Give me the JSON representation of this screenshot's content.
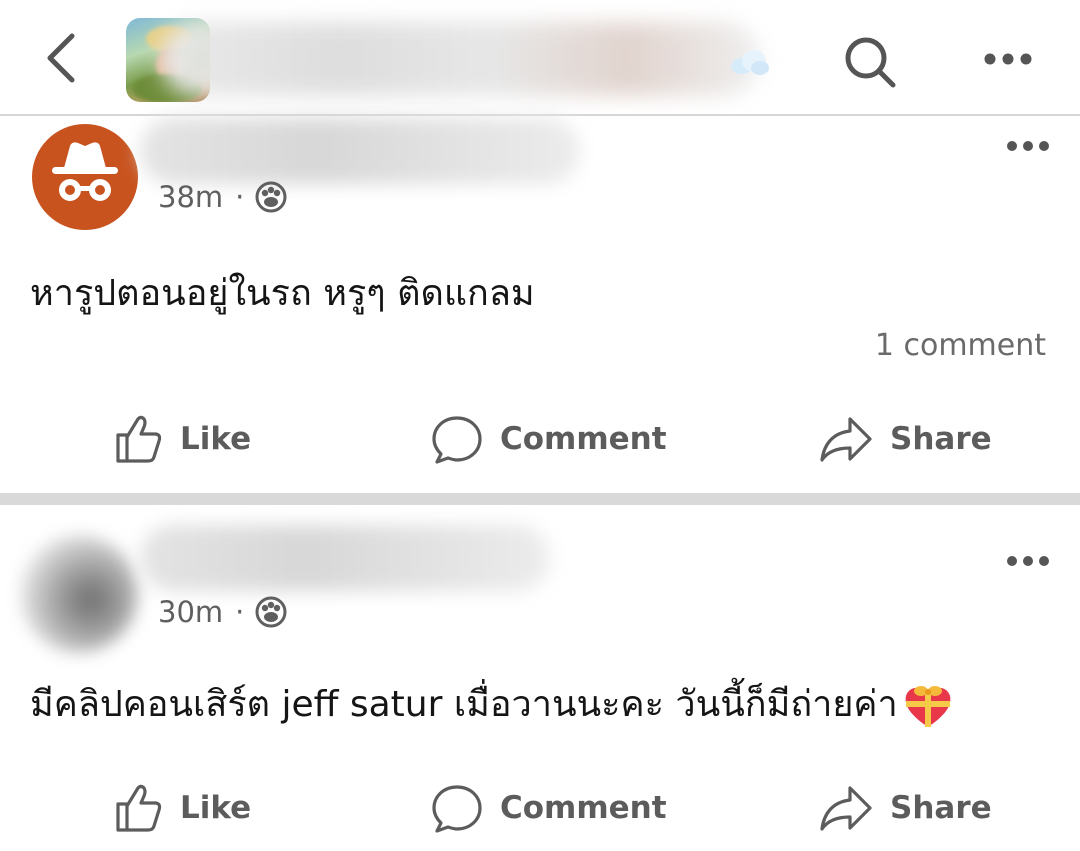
{
  "posts": [
    {
      "time": "38m",
      "dot": "·",
      "text": "หารูปตอนอยู่ในรถ หรูๆ ติดแกลม",
      "comments": "1 comment",
      "actions": {
        "like": "Like",
        "comment": "Comment",
        "share": "Share"
      }
    },
    {
      "time": "30m",
      "dot": "·",
      "text": "มีคลิปคอนเสิร์ต jeff satur เมื่อวานนะคะ วันนี้ก็มีถ่ายค่า",
      "actions": {
        "like": "Like",
        "comment": "Comment",
        "share": "Share"
      }
    }
  ],
  "icons": {
    "back": "chevron-left-icon",
    "search": "search-icon",
    "more": "more-dots-icon",
    "privacy": "group-privacy-icon",
    "like": "thumbs-up-icon",
    "comment": "comment-bubble-icon",
    "share": "share-arrow-icon",
    "emoji": "heart-gift-emoji"
  },
  "colors": {
    "anonymous_avatar": "#c8531f",
    "action_text": "#5c5c5c",
    "meta_text": "#5f5f5f",
    "separator": "#d9d9d9"
  }
}
